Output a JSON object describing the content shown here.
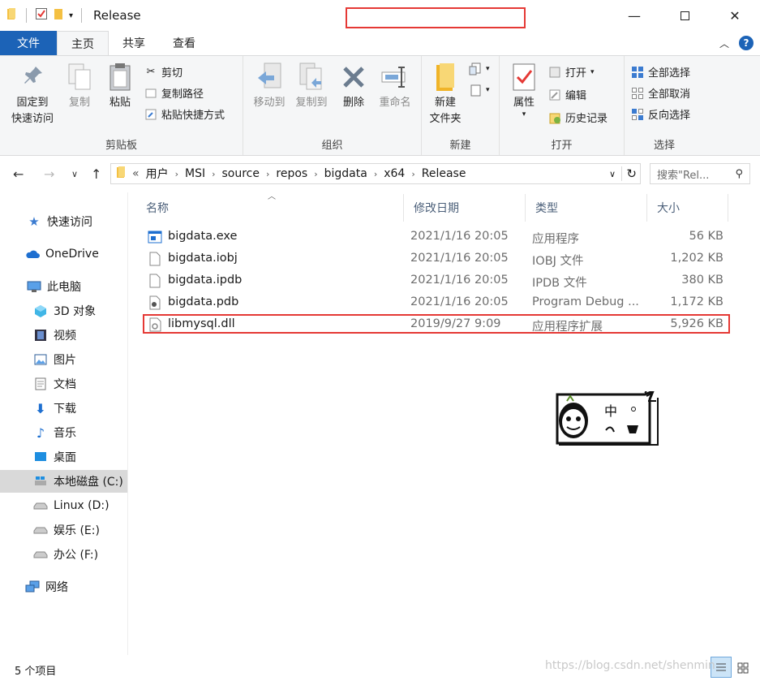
{
  "window": {
    "title": "Release",
    "controls": [
      "minimize",
      "maximize",
      "close"
    ]
  },
  "tabs": [
    {
      "label": "文件"
    },
    {
      "label": "主页"
    },
    {
      "label": "共享"
    },
    {
      "label": "查看"
    }
  ],
  "ribbon": {
    "clipboard": {
      "pin": "固定到快速访问",
      "pin_line1": "固定到",
      "pin_line2": "快速访问",
      "copy": "复制",
      "paste": "粘贴",
      "cut": "剪切",
      "copy_path": "复制路径",
      "paste_shortcut": "粘贴快捷方式",
      "label": "剪贴板"
    },
    "organize": {
      "move_to": "移动到",
      "copy_to": "复制到",
      "delete": "删除",
      "rename": "重命名",
      "label": "组织"
    },
    "new": {
      "new_folder_line1": "新建",
      "new_folder_line2": "文件夹",
      "label": "新建"
    },
    "open": {
      "properties": "属性",
      "open": "打开",
      "edit": "编辑",
      "history": "历史记录",
      "label": "打开"
    },
    "select": {
      "select_all": "全部选择",
      "select_none": "全部取消",
      "invert": "反向选择",
      "label": "选择"
    }
  },
  "address": {
    "overflow": "«",
    "crumbs": [
      "用户",
      "MSI",
      "source",
      "repos",
      "bigdata",
      "x64",
      "Release"
    ],
    "search_placeholder": "搜索\"Rel..."
  },
  "sidebar": {
    "items": [
      {
        "label": "快速访问",
        "icon": "star-icon"
      },
      {
        "label": "OneDrive",
        "icon": "cloud-icon"
      },
      {
        "label": "此电脑",
        "icon": "computer-icon"
      },
      {
        "label": "3D 对象",
        "icon": "cube-icon"
      },
      {
        "label": "视频",
        "icon": "film-icon"
      },
      {
        "label": "图片",
        "icon": "picture-icon"
      },
      {
        "label": "文档",
        "icon": "document-icon"
      },
      {
        "label": "下载",
        "icon": "download-icon"
      },
      {
        "label": "音乐",
        "icon": "music-icon"
      },
      {
        "label": "桌面",
        "icon": "desktop-icon"
      },
      {
        "label": "本地磁盘 (C:)",
        "icon": "drive-c-icon"
      },
      {
        "label": "Linux (D:)",
        "icon": "drive-icon"
      },
      {
        "label": "娱乐 (E:)",
        "icon": "drive-icon"
      },
      {
        "label": "办公 (F:)",
        "icon": "drive-icon"
      },
      {
        "label": "网络",
        "icon": "network-icon"
      }
    ]
  },
  "columns": {
    "name": "名称",
    "modified": "修改日期",
    "type": "类型",
    "size": "大小"
  },
  "files": [
    {
      "name": "bigdata.exe",
      "modified": "2021/1/16 20:05",
      "type": "应用程序",
      "size": "56 KB",
      "icon": "exe-icon"
    },
    {
      "name": "bigdata.iobj",
      "modified": "2021/1/16 20:05",
      "type": "IOBJ 文件",
      "size": "1,202 KB",
      "icon": "file-icon"
    },
    {
      "name": "bigdata.ipdb",
      "modified": "2021/1/16 20:05",
      "type": "IPDB 文件",
      "size": "380 KB",
      "icon": "file-icon"
    },
    {
      "name": "bigdata.pdb",
      "modified": "2021/1/16 20:05",
      "type": "Program Debug ...",
      "size": "1,172 KB",
      "icon": "pdb-icon"
    },
    {
      "name": "libmysql.dll",
      "modified": "2019/9/27 9:09",
      "type": "应用程序扩展",
      "size": "5,926 KB",
      "icon": "dll-icon"
    }
  ],
  "status": {
    "count": "5 个项目"
  },
  "watermark": "https://blog.csdn.net/shenmin",
  "sticker_text": "中"
}
